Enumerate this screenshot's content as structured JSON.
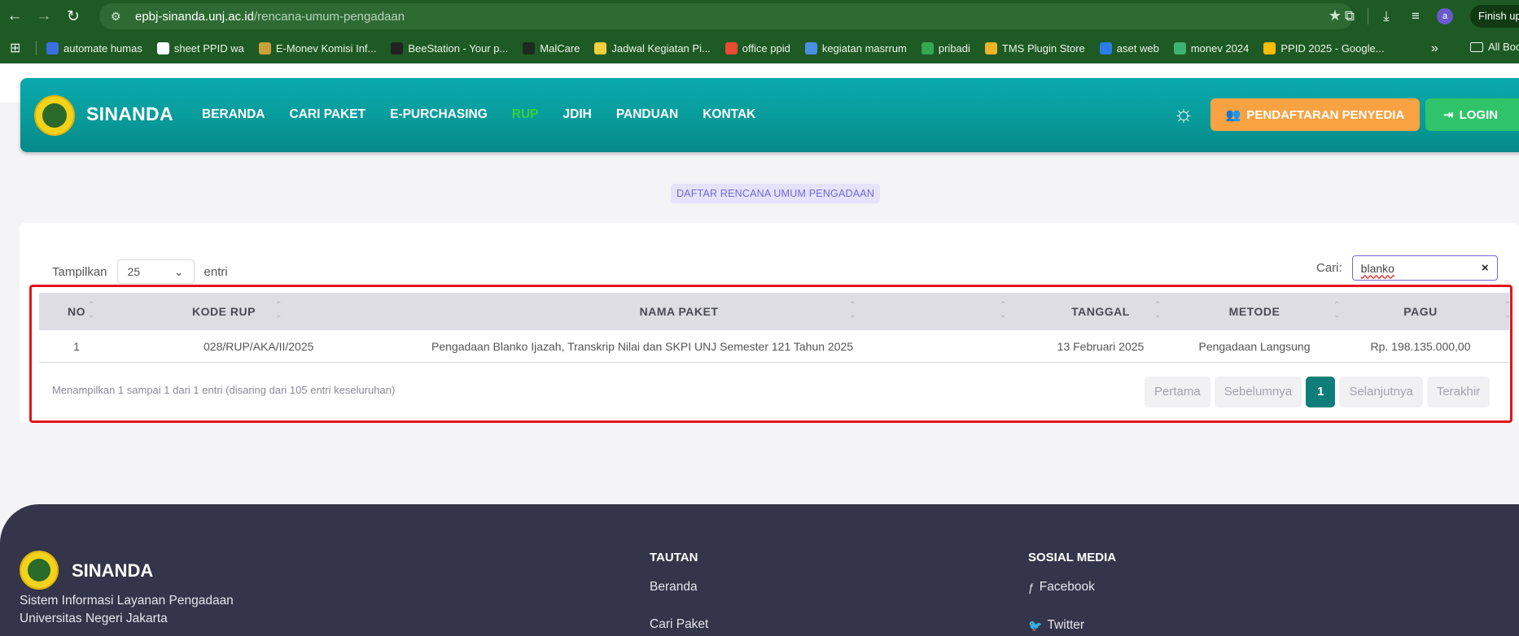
{
  "browser": {
    "url_host": "epbj-sinanda.unj.ac.id",
    "url_path": "/rencana-umum-pengadaan",
    "profile_initial": "a",
    "finish_label": "Finish update",
    "bookmarks": [
      {
        "label": "automate humas",
        "color": "#3b6fe0"
      },
      {
        "label": "sheet PPID wa",
        "color": "#ffffff"
      },
      {
        "label": "E-Monev Komisi Inf...",
        "color": "#c9a23a"
      },
      {
        "label": "BeeStation - Your p...",
        "color": "#222222"
      },
      {
        "label": "MalCare",
        "color": "#1f2a1f"
      },
      {
        "label": "Jadwal Kegiatan Pi...",
        "color": "#f4d03f"
      },
      {
        "label": "office ppid",
        "color": "#e94b35"
      },
      {
        "label": "kegiatan masrrum",
        "color": "#4a90e2"
      },
      {
        "label": "pribadi",
        "color": "#34a853"
      },
      {
        "label": "TMS Plugin Store",
        "color": "#f0b429"
      },
      {
        "label": "aset web",
        "color": "#2b7de9"
      },
      {
        "label": "monev 2024",
        "color": "#3cb371"
      },
      {
        "label": "PPID 2025 - Google...",
        "color": "#fbbc04"
      }
    ],
    "all_bookmarks_label": "All Bookmarks"
  },
  "header": {
    "brand": "SINANDA",
    "menu": [
      "BERANDA",
      "CARI PAKET",
      "E-PURCHASING",
      "RUP",
      "JDIH",
      "PANDUAN",
      "KONTAK"
    ],
    "active_menu": "RUP",
    "register_label": "PENDAFTARAN PENYEDIA",
    "login_label": "LOGIN"
  },
  "page": {
    "section_label": "DAFTAR RENCANA UMUM PENGADAAN",
    "show_label": "Tampilkan",
    "page_size": "25",
    "entries_label": "entri",
    "search_label": "Cari:",
    "search_value": "blanko"
  },
  "table": {
    "columns": [
      "NO",
      "KODE RUP",
      "NAMA PAKET",
      "TANGGAL",
      "METODE",
      "PAGU"
    ],
    "rows": [
      [
        "1",
        "028/RUP/AKA/II/2025",
        "Pengadaan Blanko Ijazah, Transkrip Nilai dan SKPI UNJ Semester 121 Tahun 2025",
        "13 Februari 2025",
        "Pengadaan Langsung",
        "Rp. 198.135.000,00"
      ]
    ],
    "info": "Menampilkan 1 sampai 1 dari 1 entri (disaring dari 105 entri keseluruhan)",
    "pagination": {
      "first": "Pertama",
      "prev": "Sebelumnya",
      "current": "1",
      "next": "Selanjutnya",
      "last": "Terakhir"
    }
  },
  "footer": {
    "brand": "SINANDA",
    "desc_line1": "Sistem Informasi Layanan Pengadaan",
    "desc_line2": "Universitas Negeri Jakarta",
    "links_title": "TAUTAN",
    "links": [
      "Beranda",
      "Cari Paket"
    ],
    "social_title": "SOSIAL MEDIA",
    "social": [
      "Facebook",
      "Twitter"
    ]
  },
  "colors": {
    "header_teal": "#089a98",
    "active_menu": "#39d13a",
    "register_btn": "#f8a241",
    "login_btn": "#30c46a",
    "highlight_border": "#e3141b",
    "pagination_active": "#0f7d7a",
    "footer_bg": "#34344a"
  }
}
